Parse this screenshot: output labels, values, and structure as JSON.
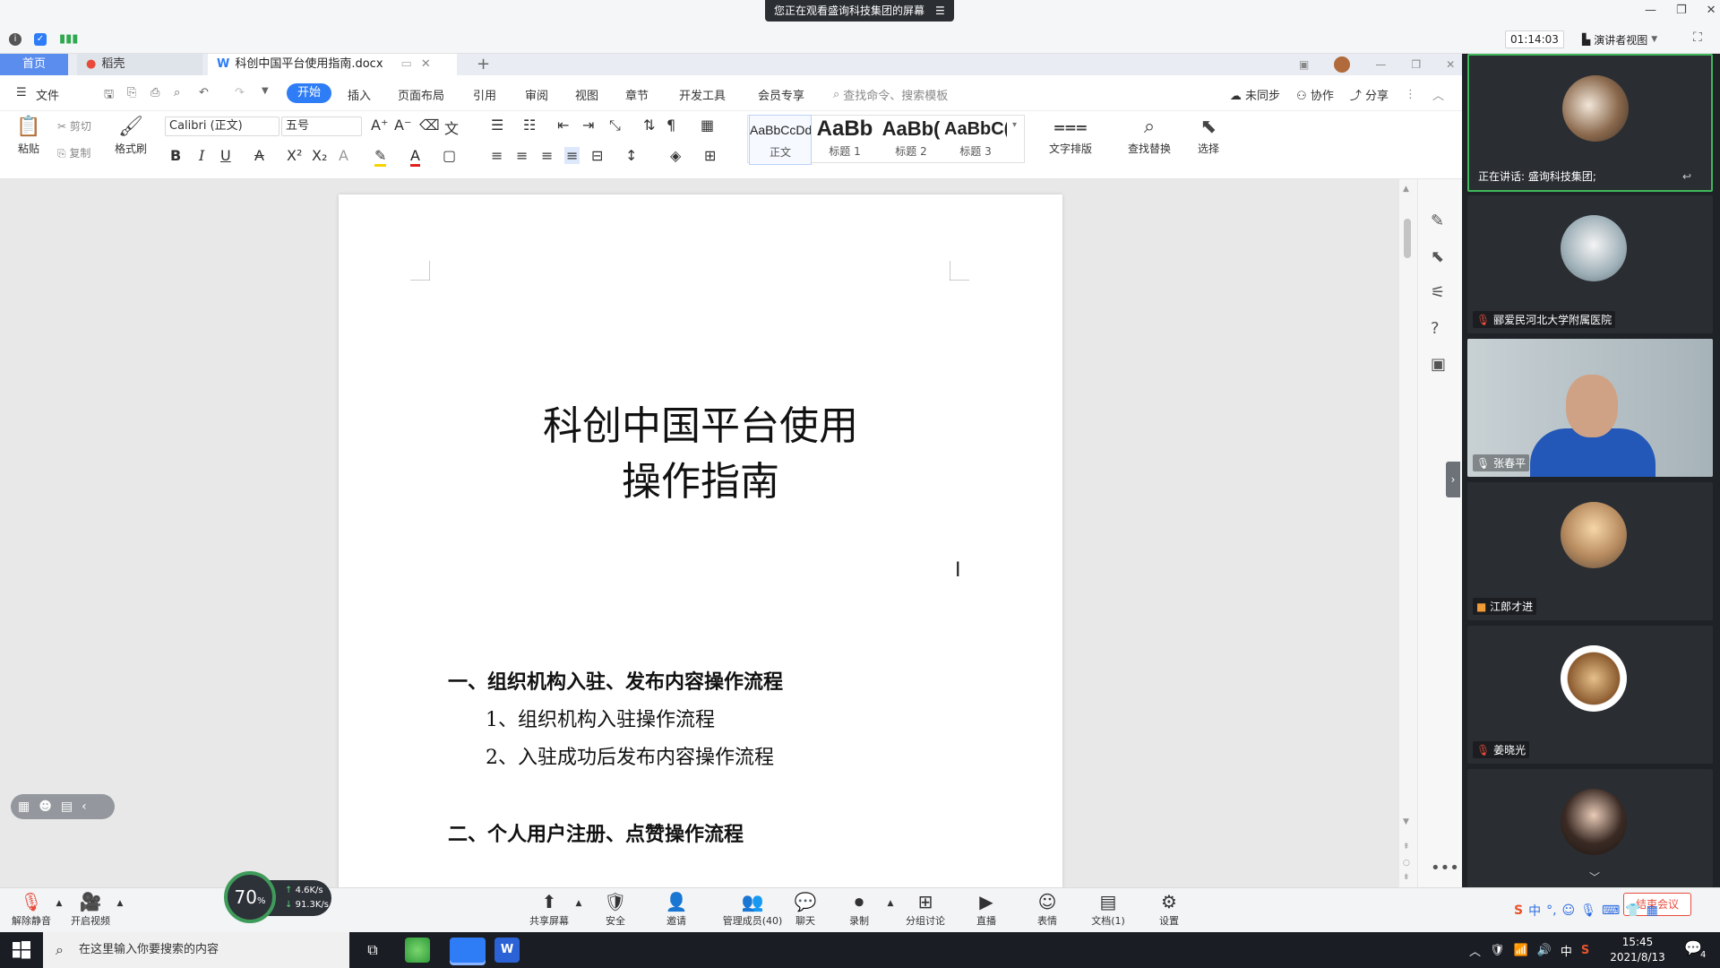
{
  "meeting": {
    "share_banner": "您正在观看盛询科技集团的屏幕",
    "timer": "01:14:03",
    "view_mode": "演讲者视图"
  },
  "wps": {
    "tabs": {
      "home": "首页",
      "daoke": "稻壳",
      "document": "科创中国平台使用指南.docx"
    },
    "menu": {
      "file": "文件",
      "items": [
        "开始",
        "插入",
        "页面布局",
        "引用",
        "审阅",
        "视图",
        "章节",
        "开发工具",
        "会员专享"
      ],
      "search_placeholder": "查找命令、搜索模板",
      "right": [
        "未同步",
        "协作",
        "分享"
      ]
    },
    "ribbon": {
      "paste": "粘贴",
      "cut": "剪切",
      "copy": "复制",
      "format_painter": "格式刷",
      "font_name": "Calibri (正文)",
      "font_size": "五号",
      "styles": [
        {
          "preview": "AaBbCcDd",
          "label": "正文"
        },
        {
          "preview": "AaBb",
          "label": "标题 1"
        },
        {
          "preview": "AaBb(",
          "label": "标题 2"
        },
        {
          "preview": "AaBbC(",
          "label": "标题 3"
        }
      ],
      "text_layout": "文字排版",
      "find_replace": "查找替换",
      "select": "选择"
    }
  },
  "document": {
    "title_line1": "科创中国平台使用",
    "title_line2": "操作指南",
    "section1": "一、组织机构入驻、发布内容操作流程",
    "item1": "1、组织机构入驻操作流程",
    "item2": "2、入驻成功后发布内容操作流程",
    "section2": "二、个人用户注册、点赞操作流程"
  },
  "participants": {
    "speaking": "正在讲话: 盛询科技集团;",
    "p1": "郦爱民河北大学附属医院",
    "p2": "张春平",
    "p3": "江郎才进",
    "p4": "姜晓光"
  },
  "toolbar": {
    "mute": "解除静音",
    "video": "开启视频",
    "speed_percent": "70",
    "up_speed": "4.6K/s",
    "down_speed": "91.3K/s",
    "items": [
      "共享屏幕",
      "安全",
      "邀请",
      "管理成员(40)",
      "聊天",
      "录制",
      "分组讨论",
      "直播",
      "表情",
      "文档(1)",
      "设置"
    ],
    "end": "结束会议"
  },
  "taskbar": {
    "search_placeholder": "在这里输入你要搜索的内容",
    "ime": "中",
    "time": "15:45",
    "date": "2021/8/13",
    "notifications": "4"
  },
  "colors": {
    "accent": "#2e7df6",
    "panel_bg": "#1f2227",
    "speaking_border": "#3fb85c"
  }
}
